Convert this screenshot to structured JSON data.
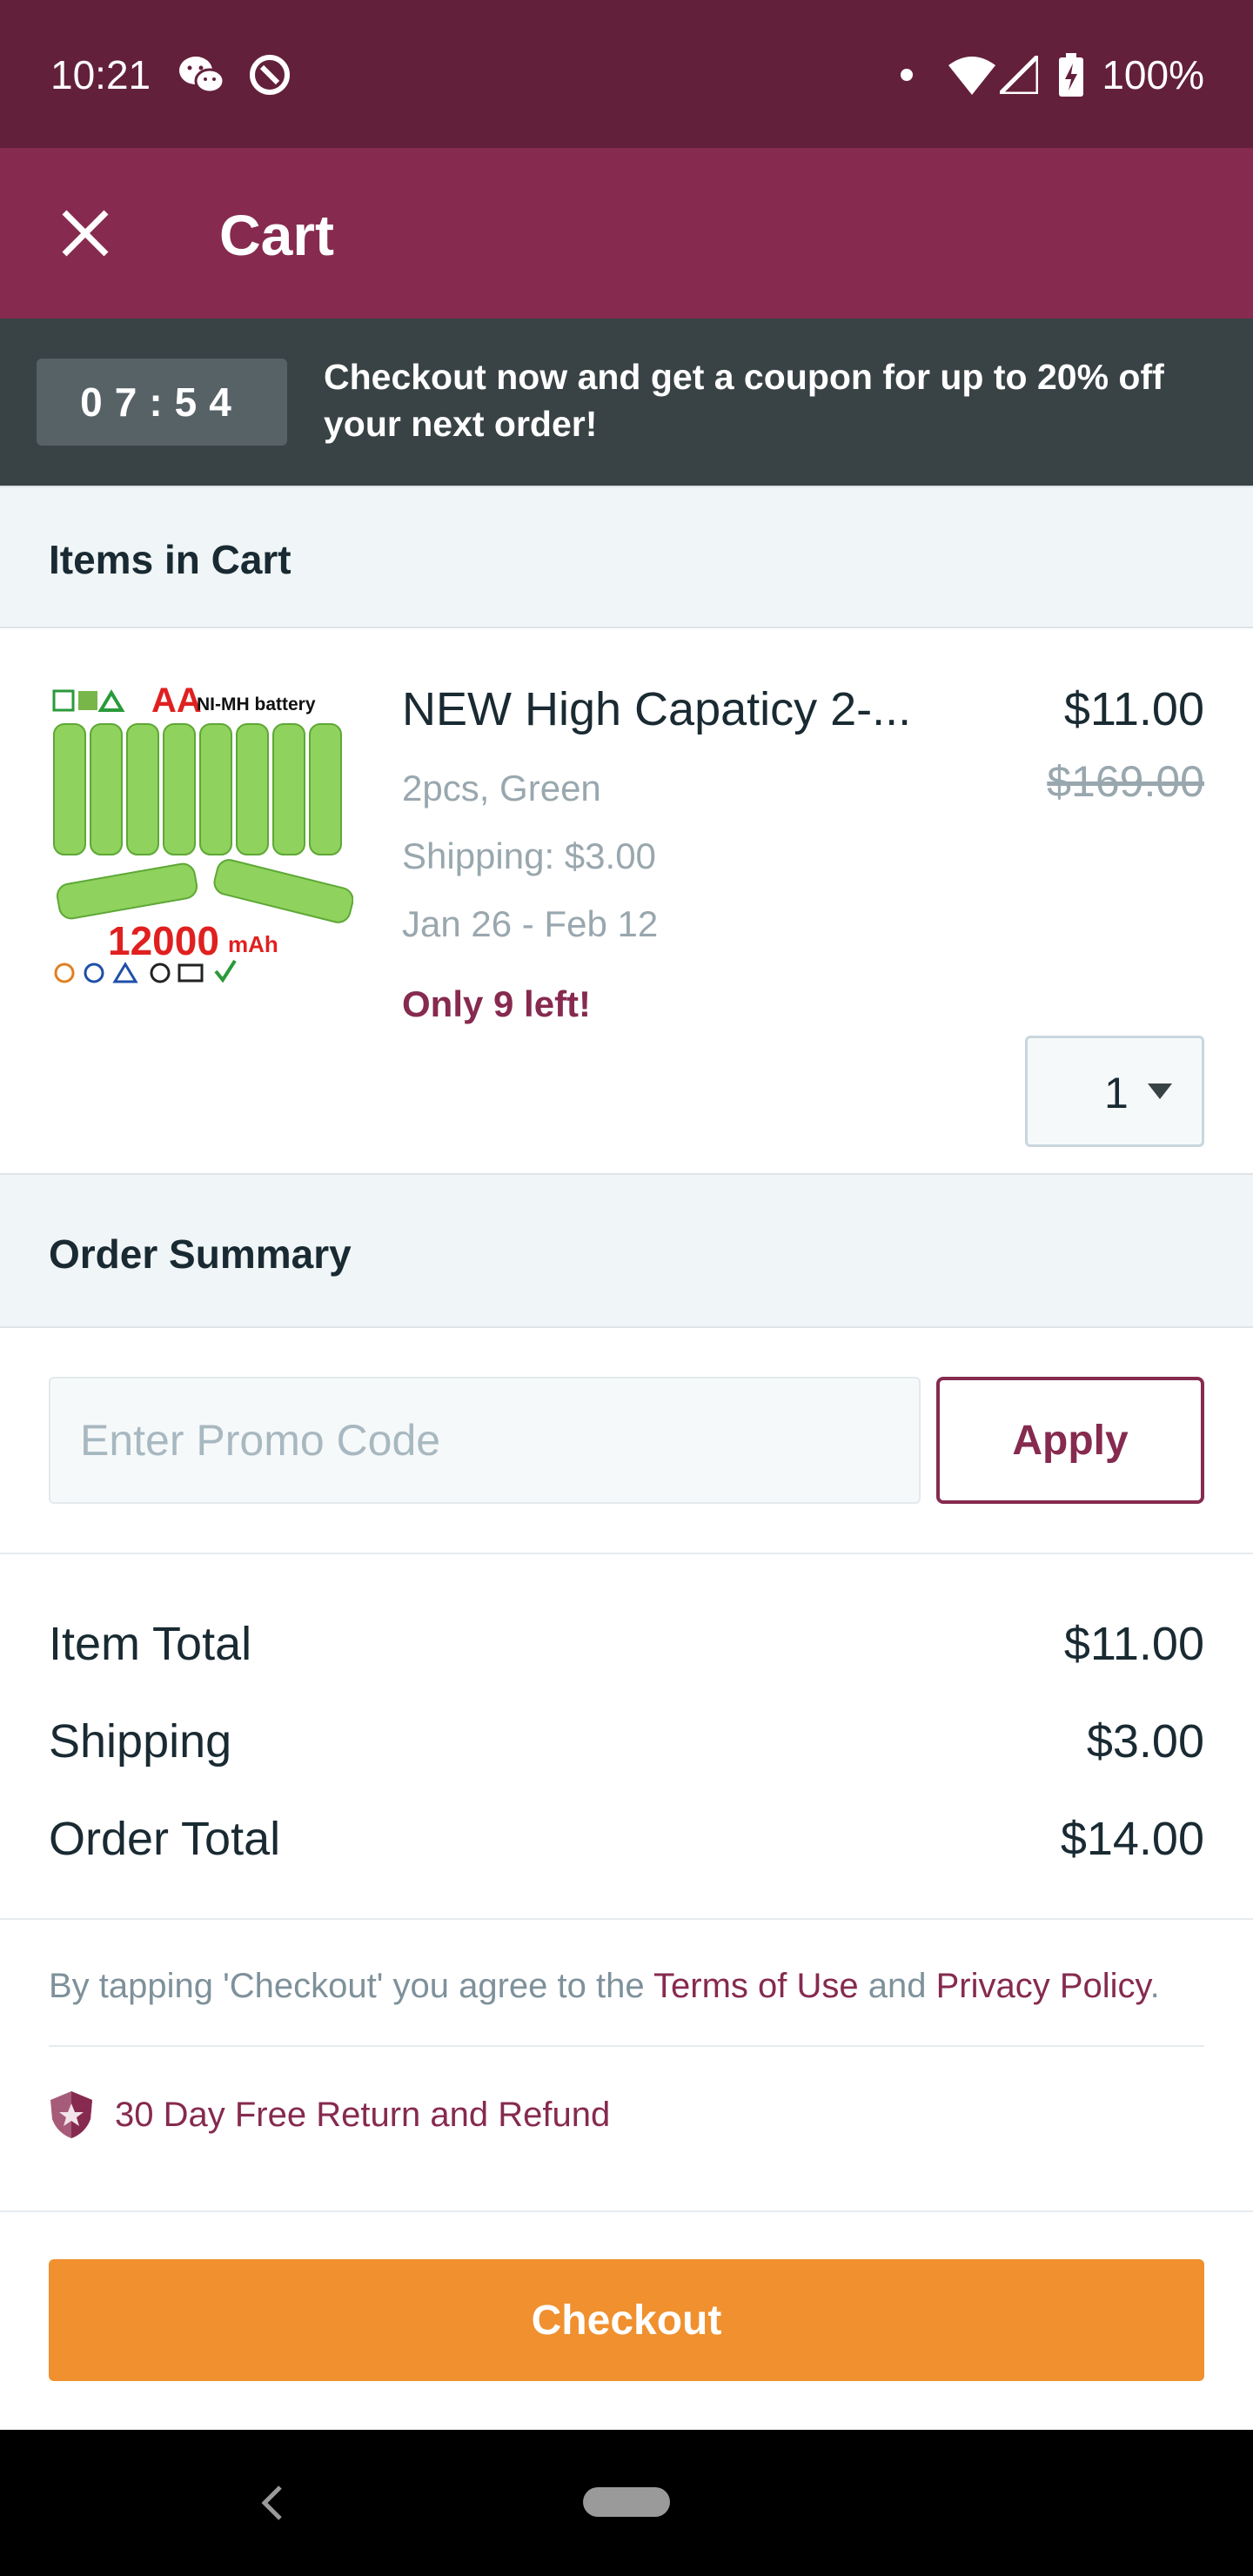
{
  "status_bar": {
    "time": "10:21",
    "battery": "100%",
    "icons": [
      "wechat-icon",
      "at-sign-icon",
      "dot-icon",
      "wifi-icon",
      "cell-signal-icon",
      "battery-charging-icon"
    ]
  },
  "header": {
    "title": "Cart",
    "close_icon": "close-icon"
  },
  "promo_banner": {
    "timer": "07:54",
    "message": "Checkout now and get a coupon for up to 20% off your next order!"
  },
  "cart": {
    "section_title": "Items in Cart",
    "items": [
      {
        "image_text": {
          "line1": "AA",
          "line2": "NI-MH battery",
          "capacity": "12000",
          "unit": "mAh"
        },
        "name": "NEW High Capaticy 2-...",
        "price": "$11.00",
        "original_price": "$169.00",
        "variant": "2pcs, Green",
        "shipping": "Shipping: $3.00",
        "delivery_window": "Jan 26 - Feb 12",
        "stock_note": "Only 9 left!",
        "quantity": "1"
      }
    ]
  },
  "order_summary": {
    "section_title": "Order Summary",
    "promo_placeholder": "Enter Promo Code",
    "apply_label": "Apply",
    "rows": [
      {
        "label": "Item Total",
        "value": "$11.00"
      },
      {
        "label": "Shipping",
        "value": "$3.00"
      },
      {
        "label": "Order Total",
        "value": "$14.00"
      }
    ],
    "terms": {
      "prefix": "By tapping 'Checkout' you agree to the ",
      "terms_link": "Terms of Use",
      "middle": " and ",
      "privacy_link": "Privacy Policy",
      "suffix": "."
    },
    "refund_policy": "30 Day Free Return and Refund",
    "checkout_label": "Checkout"
  },
  "colors": {
    "status_bar": "#63203a",
    "header": "#862a4f",
    "banner": "#394245",
    "accent": "#862a4f",
    "checkout": "#f0902f"
  }
}
